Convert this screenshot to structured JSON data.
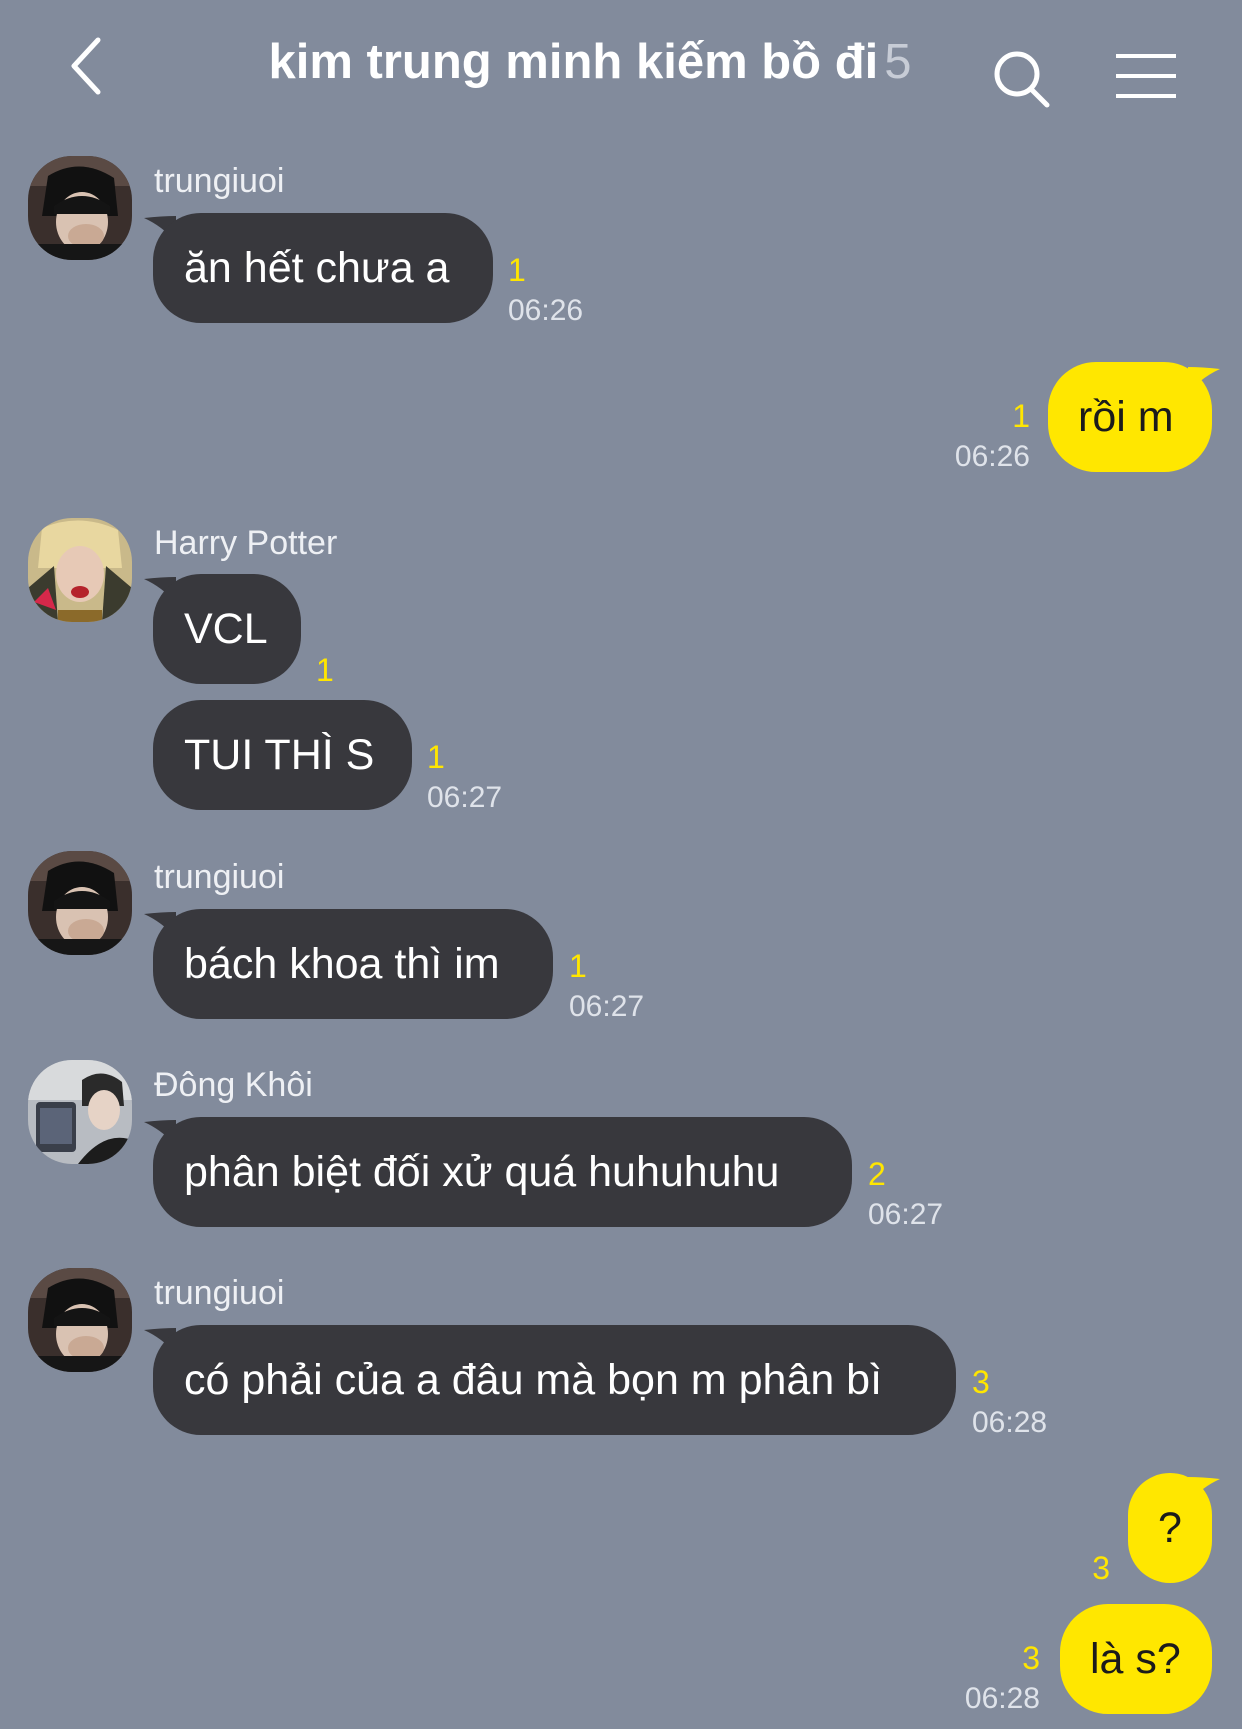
{
  "header": {
    "title": "kim trung minh kiếm bồ đi",
    "member_count": "5",
    "back_icon": "chevron-left-icon",
    "search_icon": "search-icon",
    "menu_icon": "menu-icon"
  },
  "colors": {
    "background": "#828b9c",
    "incoming_bubble": "#38383d",
    "outgoing_bubble": "#ffe700",
    "unread_count": "#ffe600"
  },
  "messages": [
    {
      "sender": "trungiuoi",
      "text": "ăn hết chưa a",
      "unread": "1",
      "time": "06:26"
    },
    {
      "sender": "me",
      "text": "rồi m",
      "unread": "1",
      "time": "06:26"
    },
    {
      "sender": "Harry Potter",
      "text": "VCL",
      "unread": "1",
      "time": ""
    },
    {
      "sender": "Harry Potter",
      "text": "TUI THÌ S",
      "unread": "1",
      "time": "06:27"
    },
    {
      "sender": "trungiuoi",
      "text": "bách khoa thì im",
      "unread": "1",
      "time": "06:27"
    },
    {
      "sender": "Đông Khôi",
      "text": "phân biệt đối xử quá huhuhuhu",
      "unread": "2",
      "time": "06:27"
    },
    {
      "sender": "trungiuoi",
      "text": "có phải của a đâu mà bọn m phân bì",
      "unread": "3",
      "time": "06:28"
    },
    {
      "sender": "me",
      "text": "?",
      "unread": "3",
      "time": ""
    },
    {
      "sender": "me",
      "text": "là s?",
      "unread": "3",
      "time": "06:28"
    }
  ]
}
